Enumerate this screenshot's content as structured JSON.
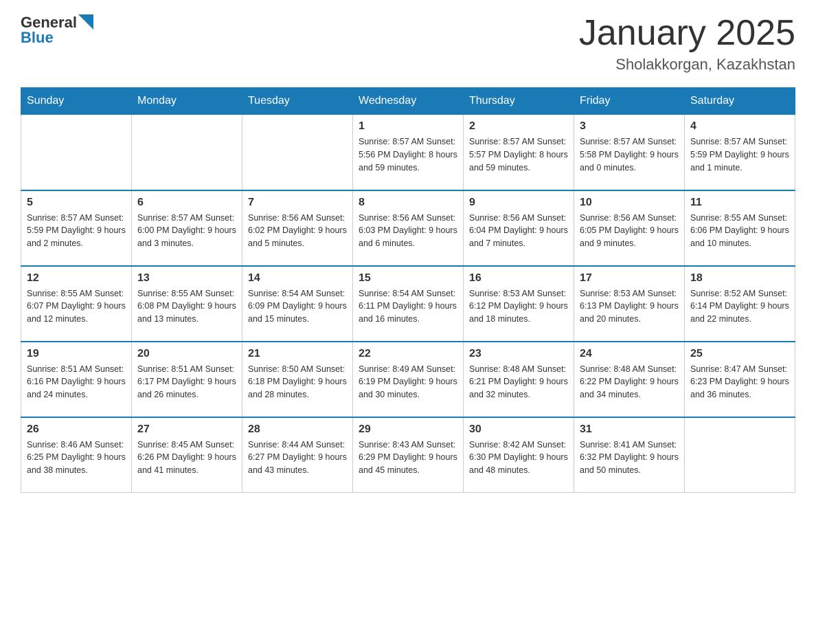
{
  "header": {
    "logo_general": "General",
    "logo_blue": "Blue",
    "month_title": "January 2025",
    "location": "Sholakkorgan, Kazakhstan"
  },
  "weekdays": [
    "Sunday",
    "Monday",
    "Tuesday",
    "Wednesday",
    "Thursday",
    "Friday",
    "Saturday"
  ],
  "weeks": [
    [
      {
        "day": "",
        "info": ""
      },
      {
        "day": "",
        "info": ""
      },
      {
        "day": "",
        "info": ""
      },
      {
        "day": "1",
        "info": "Sunrise: 8:57 AM\nSunset: 5:56 PM\nDaylight: 8 hours\nand 59 minutes."
      },
      {
        "day": "2",
        "info": "Sunrise: 8:57 AM\nSunset: 5:57 PM\nDaylight: 8 hours\nand 59 minutes."
      },
      {
        "day": "3",
        "info": "Sunrise: 8:57 AM\nSunset: 5:58 PM\nDaylight: 9 hours\nand 0 minutes."
      },
      {
        "day": "4",
        "info": "Sunrise: 8:57 AM\nSunset: 5:59 PM\nDaylight: 9 hours\nand 1 minute."
      }
    ],
    [
      {
        "day": "5",
        "info": "Sunrise: 8:57 AM\nSunset: 5:59 PM\nDaylight: 9 hours\nand 2 minutes."
      },
      {
        "day": "6",
        "info": "Sunrise: 8:57 AM\nSunset: 6:00 PM\nDaylight: 9 hours\nand 3 minutes."
      },
      {
        "day": "7",
        "info": "Sunrise: 8:56 AM\nSunset: 6:02 PM\nDaylight: 9 hours\nand 5 minutes."
      },
      {
        "day": "8",
        "info": "Sunrise: 8:56 AM\nSunset: 6:03 PM\nDaylight: 9 hours\nand 6 minutes."
      },
      {
        "day": "9",
        "info": "Sunrise: 8:56 AM\nSunset: 6:04 PM\nDaylight: 9 hours\nand 7 minutes."
      },
      {
        "day": "10",
        "info": "Sunrise: 8:56 AM\nSunset: 6:05 PM\nDaylight: 9 hours\nand 9 minutes."
      },
      {
        "day": "11",
        "info": "Sunrise: 8:55 AM\nSunset: 6:06 PM\nDaylight: 9 hours\nand 10 minutes."
      }
    ],
    [
      {
        "day": "12",
        "info": "Sunrise: 8:55 AM\nSunset: 6:07 PM\nDaylight: 9 hours\nand 12 minutes."
      },
      {
        "day": "13",
        "info": "Sunrise: 8:55 AM\nSunset: 6:08 PM\nDaylight: 9 hours\nand 13 minutes."
      },
      {
        "day": "14",
        "info": "Sunrise: 8:54 AM\nSunset: 6:09 PM\nDaylight: 9 hours\nand 15 minutes."
      },
      {
        "day": "15",
        "info": "Sunrise: 8:54 AM\nSunset: 6:11 PM\nDaylight: 9 hours\nand 16 minutes."
      },
      {
        "day": "16",
        "info": "Sunrise: 8:53 AM\nSunset: 6:12 PM\nDaylight: 9 hours\nand 18 minutes."
      },
      {
        "day": "17",
        "info": "Sunrise: 8:53 AM\nSunset: 6:13 PM\nDaylight: 9 hours\nand 20 minutes."
      },
      {
        "day": "18",
        "info": "Sunrise: 8:52 AM\nSunset: 6:14 PM\nDaylight: 9 hours\nand 22 minutes."
      }
    ],
    [
      {
        "day": "19",
        "info": "Sunrise: 8:51 AM\nSunset: 6:16 PM\nDaylight: 9 hours\nand 24 minutes."
      },
      {
        "day": "20",
        "info": "Sunrise: 8:51 AM\nSunset: 6:17 PM\nDaylight: 9 hours\nand 26 minutes."
      },
      {
        "day": "21",
        "info": "Sunrise: 8:50 AM\nSunset: 6:18 PM\nDaylight: 9 hours\nand 28 minutes."
      },
      {
        "day": "22",
        "info": "Sunrise: 8:49 AM\nSunset: 6:19 PM\nDaylight: 9 hours\nand 30 minutes."
      },
      {
        "day": "23",
        "info": "Sunrise: 8:48 AM\nSunset: 6:21 PM\nDaylight: 9 hours\nand 32 minutes."
      },
      {
        "day": "24",
        "info": "Sunrise: 8:48 AM\nSunset: 6:22 PM\nDaylight: 9 hours\nand 34 minutes."
      },
      {
        "day": "25",
        "info": "Sunrise: 8:47 AM\nSunset: 6:23 PM\nDaylight: 9 hours\nand 36 minutes."
      }
    ],
    [
      {
        "day": "26",
        "info": "Sunrise: 8:46 AM\nSunset: 6:25 PM\nDaylight: 9 hours\nand 38 minutes."
      },
      {
        "day": "27",
        "info": "Sunrise: 8:45 AM\nSunset: 6:26 PM\nDaylight: 9 hours\nand 41 minutes."
      },
      {
        "day": "28",
        "info": "Sunrise: 8:44 AM\nSunset: 6:27 PM\nDaylight: 9 hours\nand 43 minutes."
      },
      {
        "day": "29",
        "info": "Sunrise: 8:43 AM\nSunset: 6:29 PM\nDaylight: 9 hours\nand 45 minutes."
      },
      {
        "day": "30",
        "info": "Sunrise: 8:42 AM\nSunset: 6:30 PM\nDaylight: 9 hours\nand 48 minutes."
      },
      {
        "day": "31",
        "info": "Sunrise: 8:41 AM\nSunset: 6:32 PM\nDaylight: 9 hours\nand 50 minutes."
      },
      {
        "day": "",
        "info": ""
      }
    ]
  ]
}
